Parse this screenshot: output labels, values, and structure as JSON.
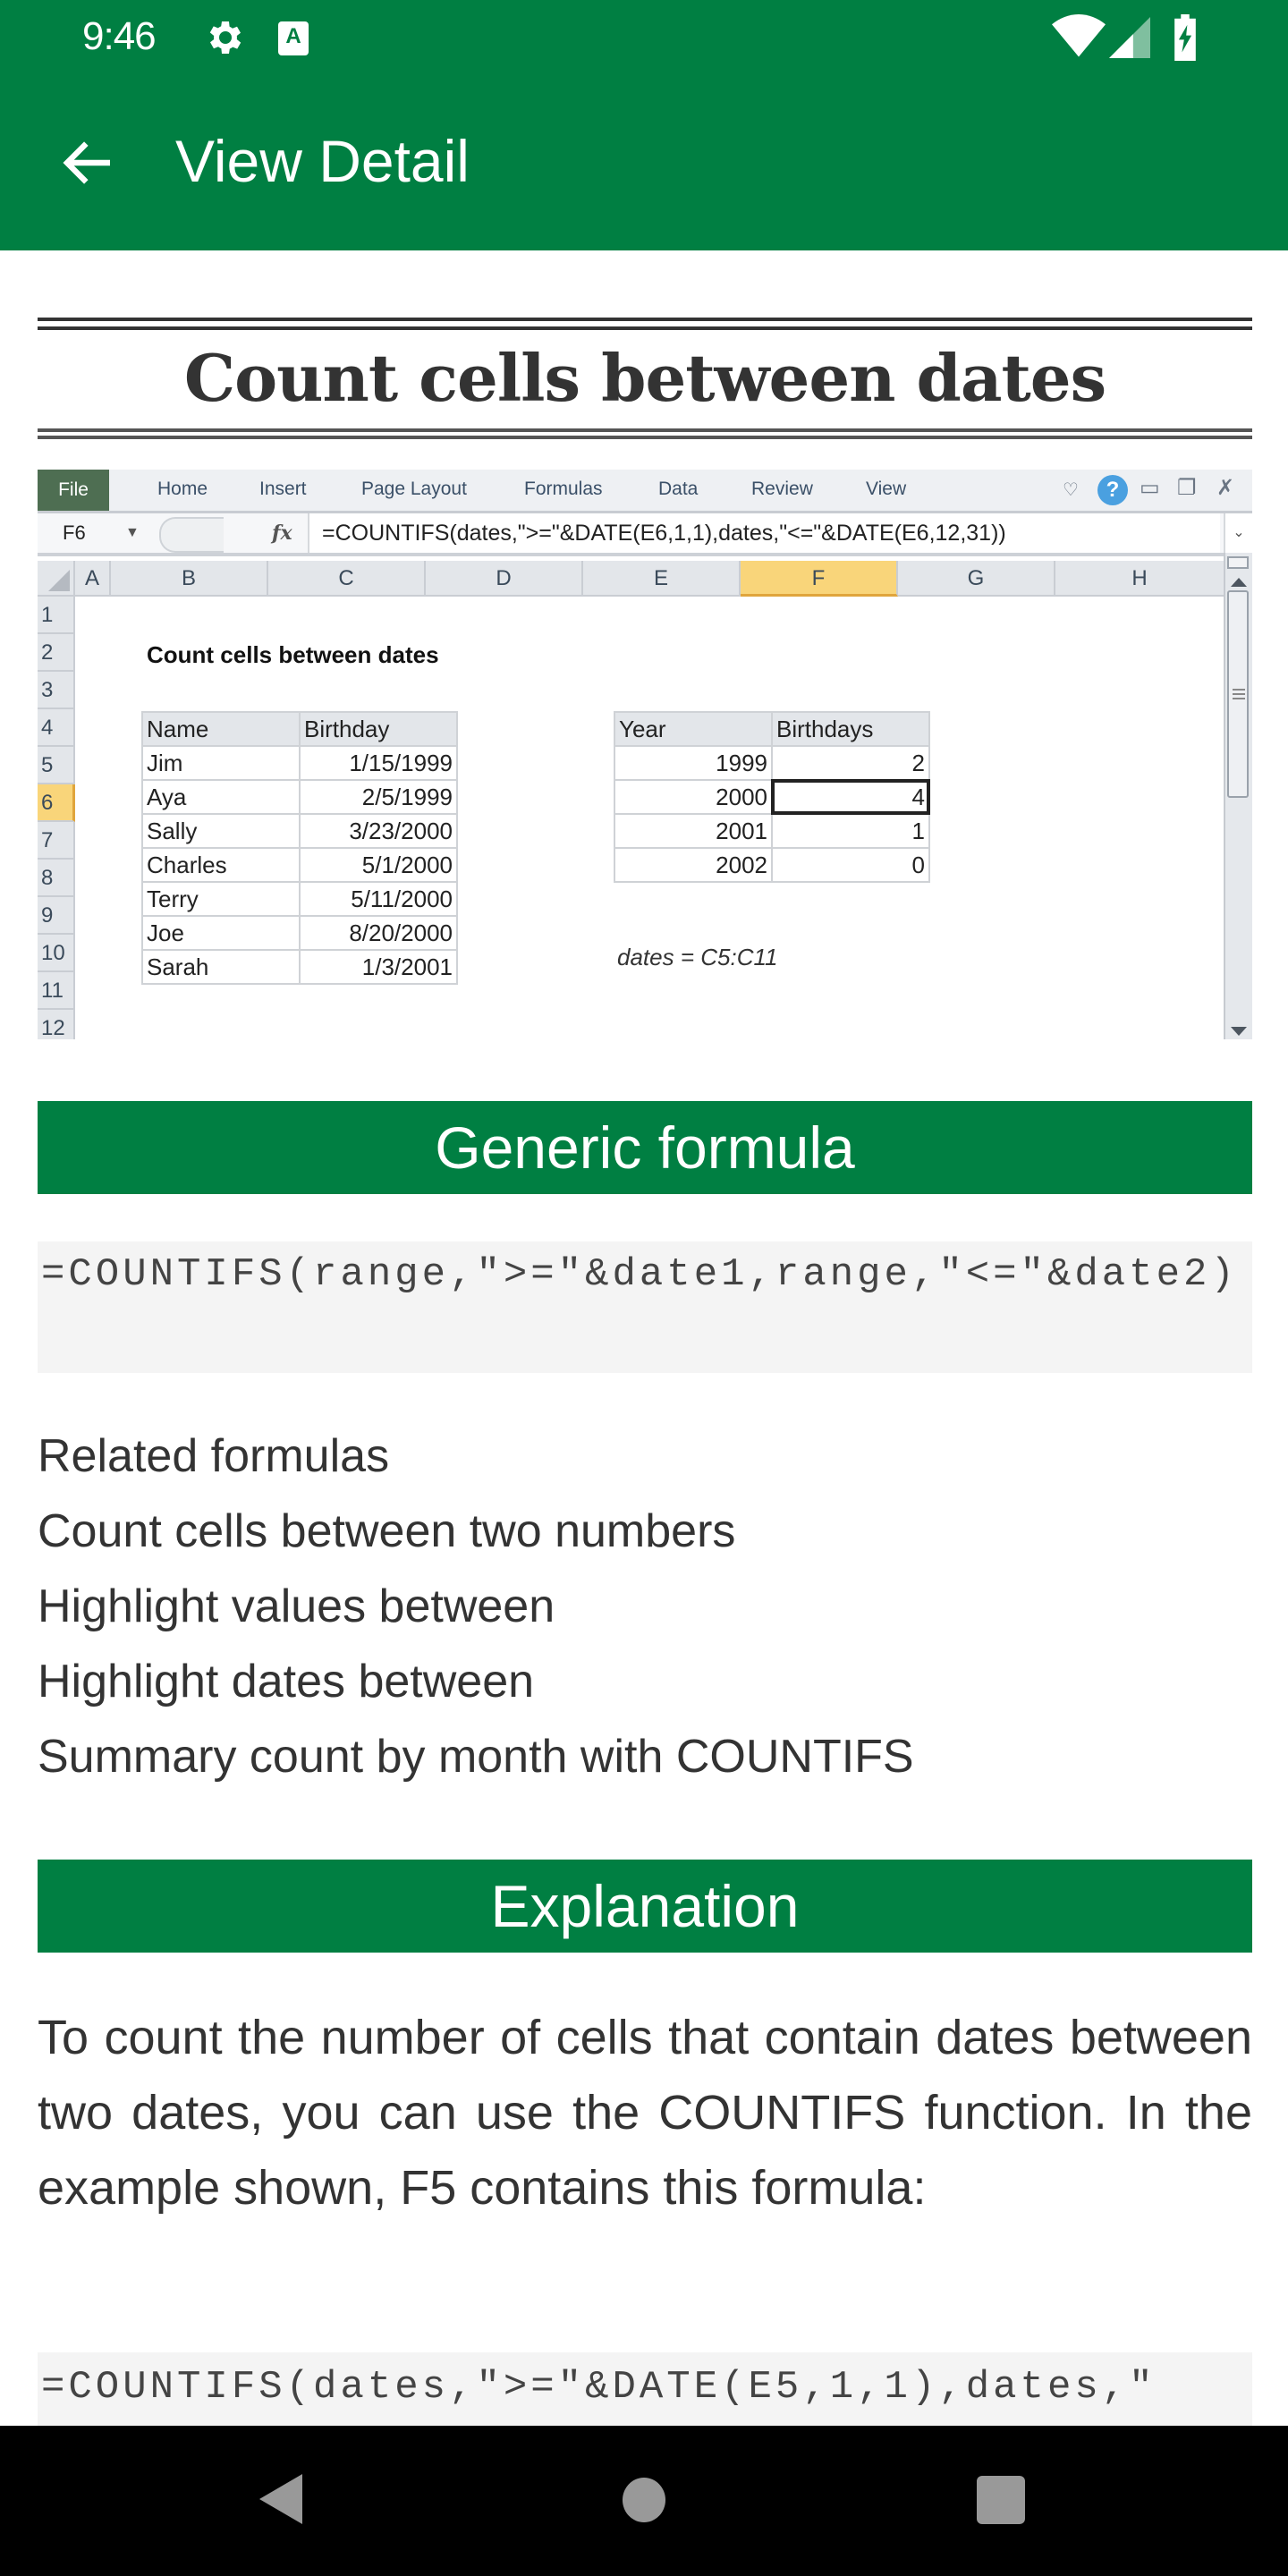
{
  "status_bar": {
    "time": "9:46",
    "icons": [
      "settings-gear-icon",
      "keyboard-a-icon",
      "wifi-icon",
      "cell-signal-icon",
      "battery-charging-icon"
    ]
  },
  "app_bar": {
    "back_icon": "arrow-left-icon",
    "title": "View Detail"
  },
  "article": {
    "title": "Count cells between dates"
  },
  "excel_screenshot": {
    "ribbon_tabs": [
      "File",
      "Home",
      "Insert",
      "Page Layout",
      "Formulas",
      "Data",
      "Review",
      "View"
    ],
    "window_controls": [
      "ribbon-collapse-icon",
      "help-icon",
      "minimize-icon",
      "restore-icon",
      "close-icon"
    ],
    "help_glyph": "?",
    "name_box": "F6",
    "fx_label": "fx",
    "formula": "=COUNTIFS(dates,\">=\"&DATE(E6,1,1),dates,\"<=\"&DATE(E6,12,31))",
    "columns": [
      "A",
      "B",
      "C",
      "D",
      "E",
      "F",
      "G",
      "H"
    ],
    "selected_column": "F",
    "rows": [
      "1",
      "2",
      "3",
      "4",
      "5",
      "6",
      "7",
      "8",
      "9",
      "10",
      "11",
      "12"
    ],
    "selected_row": "6",
    "sheet_title": "Count cells between dates",
    "birthdays_table": {
      "headers": [
        "Name",
        "Birthday"
      ],
      "rows": [
        [
          "Jim",
          "1/15/1999"
        ],
        [
          "Aya",
          "2/5/1999"
        ],
        [
          "Sally",
          "3/23/2000"
        ],
        [
          "Charles",
          "5/1/2000"
        ],
        [
          "Terry",
          "5/11/2000"
        ],
        [
          "Joe",
          "8/20/2000"
        ],
        [
          "Sarah",
          "1/3/2001"
        ]
      ]
    },
    "summary_table": {
      "headers": [
        "Year",
        "Birthdays"
      ],
      "rows": [
        [
          "1999",
          "2"
        ],
        [
          "2000",
          "4"
        ],
        [
          "2001",
          "1"
        ],
        [
          "2002",
          "0"
        ]
      ],
      "active_cell": "F6"
    },
    "named_range_note": "dates = C5:C11"
  },
  "generic_formula": {
    "header": "Generic formula",
    "code": "=COUNTIFS(range,\">=\"&date1,range,\"<=\"&date2)"
  },
  "related": {
    "heading": "Related formulas",
    "links": [
      "Count cells between two numbers",
      "Highlight values between",
      "Highlight dates between",
      "Summary count by month with COUNTIFS"
    ]
  },
  "explanation": {
    "header": "Explanation",
    "paragraph": "To count the number of cells that contain dates between two dates, you can use the COUNTIFS function. In the example shown, F5 contains this formula:",
    "code": "=COUNTIFS(dates,\">=\"&DATE(E5,1,1),dates,\""
  },
  "nav_bar": {
    "buttons": [
      "back-triangle-icon",
      "home-circle-icon",
      "recents-square-icon"
    ]
  },
  "colors": {
    "brand_green": "#007f42",
    "code_background": "#f4f4f4",
    "selected_header": "#f9d57a",
    "help_blue": "#4aa0e0"
  }
}
